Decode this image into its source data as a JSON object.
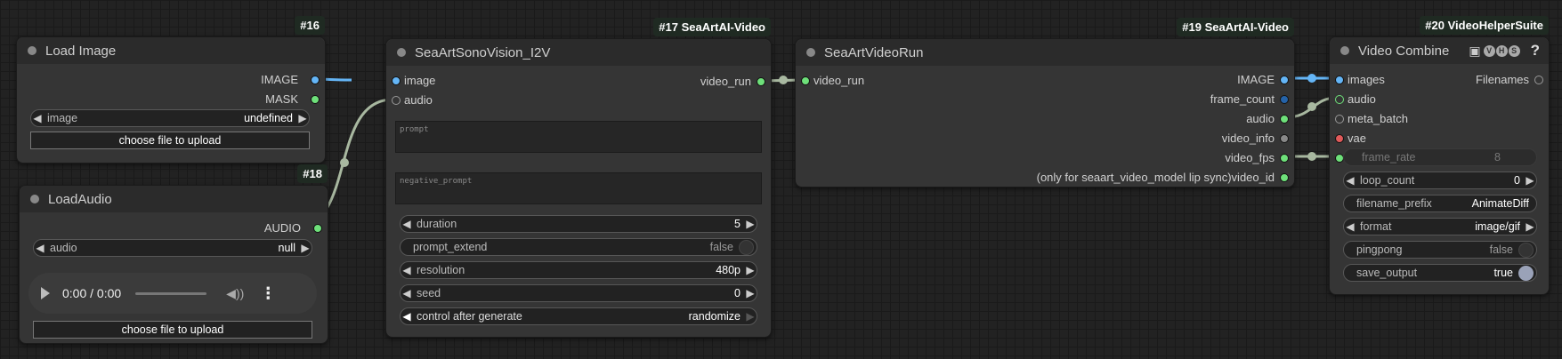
{
  "colors": {
    "image_link": "#64b5f6",
    "audio_link": "#a8b8a0",
    "canvas": "#222222",
    "node_bg": "#353535"
  },
  "nodes": {
    "load_image": {
      "id": "#16",
      "title": "Load Image",
      "outputs": [
        "IMAGE",
        "MASK"
      ],
      "image_widget": {
        "label": "image",
        "value": "undefined"
      },
      "upload_label": "choose file to upload"
    },
    "load_audio": {
      "id": "#18",
      "title": "LoadAudio",
      "outputs": [
        "AUDIO"
      ],
      "audio_widget": {
        "label": "audio",
        "value": "null"
      },
      "player_time": "0:00 / 0:00",
      "upload_label": "choose file to upload"
    },
    "sono_vision": {
      "id": "#17 SeaArtAI-Video",
      "title": "SeaArtSonoVision_I2V",
      "inputs": [
        "image",
        "audio"
      ],
      "outputs": [
        "video_run"
      ],
      "prompt_placeholder": "prompt",
      "negative_placeholder": "negative_prompt",
      "widgets": {
        "duration": {
          "label": "duration",
          "value": "5"
        },
        "prompt_extend": {
          "label": "prompt_extend",
          "value": "false"
        },
        "resolution": {
          "label": "resolution",
          "value": "480p"
        },
        "seed": {
          "label": "seed",
          "value": "0"
        },
        "control": {
          "label": "control after generate",
          "value": "randomize"
        }
      }
    },
    "video_run": {
      "id": "#19 SeaArtAI-Video",
      "title": "SeaArtVideoRun",
      "inputs": [
        "video_run"
      ],
      "outputs": [
        "IMAGE",
        "frame_count",
        "audio",
        "video_info",
        "video_fps",
        "(only for seaart_video_model lip sync)video_id"
      ]
    },
    "video_combine": {
      "id": "#20 VideoHelperSuite",
      "title": "Video Combine",
      "tag_icon": "film-icon",
      "tag_letters": [
        "V",
        "H",
        "S"
      ],
      "help": "?",
      "inputs": [
        "images",
        "audio",
        "meta_batch",
        "vae"
      ],
      "outputs": [
        "Filenames"
      ],
      "widgets": {
        "frame_rate": {
          "label": "frame_rate",
          "value": "8"
        },
        "loop_count": {
          "label": "loop_count",
          "value": "0"
        },
        "filename_prefix": {
          "label": "filename_prefix",
          "value": "AnimateDiff"
        },
        "format": {
          "label": "format",
          "value": "image/gif"
        },
        "pingpong": {
          "label": "pingpong",
          "value": "false"
        },
        "save_output": {
          "label": "save_output",
          "value": "true"
        }
      }
    }
  }
}
